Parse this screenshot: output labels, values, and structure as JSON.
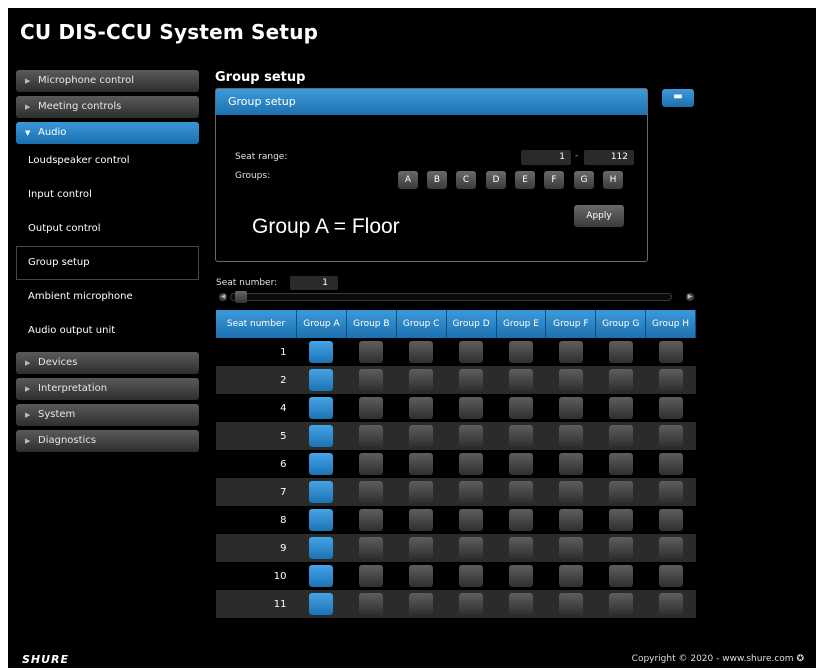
{
  "app_title": "CU DIS-CCU System Setup",
  "sidebar": {
    "items": [
      {
        "label": "Microphone control"
      },
      {
        "label": "Meeting controls"
      },
      {
        "label": "Audio"
      },
      {
        "label": "Devices"
      },
      {
        "label": "Interpretation"
      },
      {
        "label": "System"
      },
      {
        "label": "Diagnostics"
      }
    ],
    "audio_subitems": [
      {
        "label": "Loudspeaker control"
      },
      {
        "label": "Input control"
      },
      {
        "label": "Output control"
      },
      {
        "label": "Group setup"
      },
      {
        "label": "Ambient microphone"
      },
      {
        "label": "Audio output unit"
      }
    ]
  },
  "main": {
    "section_title": "Group setup",
    "panel": {
      "header": "Group setup",
      "seat_range_label": "Seat range:",
      "seat_range_from": "1",
      "seat_range_dash": "-",
      "seat_range_to": "112",
      "groups_label": "Groups:",
      "group_letters": [
        "A",
        "B",
        "C",
        "D",
        "E",
        "F",
        "G",
        "H"
      ],
      "apply_label": "Apply",
      "annotation": "Group A = Floor"
    },
    "seat_number_label": "Seat number:",
    "seat_number_value": "1",
    "table": {
      "headers": [
        "Seat number",
        "Group A",
        "Group B",
        "Group C",
        "Group D",
        "Group E",
        "Group F",
        "Group G",
        "Group H"
      ],
      "rows": [
        {
          "seat": "1",
          "groups": [
            true,
            false,
            false,
            false,
            false,
            false,
            false,
            false
          ]
        },
        {
          "seat": "2",
          "groups": [
            true,
            false,
            false,
            false,
            false,
            false,
            false,
            false
          ]
        },
        {
          "seat": "4",
          "groups": [
            true,
            false,
            false,
            false,
            false,
            false,
            false,
            false
          ]
        },
        {
          "seat": "5",
          "groups": [
            true,
            false,
            false,
            false,
            false,
            false,
            false,
            false
          ]
        },
        {
          "seat": "6",
          "groups": [
            true,
            false,
            false,
            false,
            false,
            false,
            false,
            false
          ]
        },
        {
          "seat": "7",
          "groups": [
            true,
            false,
            false,
            false,
            false,
            false,
            false,
            false
          ]
        },
        {
          "seat": "8",
          "groups": [
            true,
            false,
            false,
            false,
            false,
            false,
            false,
            false
          ]
        },
        {
          "seat": "9",
          "groups": [
            true,
            false,
            false,
            false,
            false,
            false,
            false,
            false
          ]
        },
        {
          "seat": "10",
          "groups": [
            true,
            false,
            false,
            false,
            false,
            false,
            false,
            false
          ]
        },
        {
          "seat": "11",
          "groups": [
            true,
            false,
            false,
            false,
            false,
            false,
            false,
            false
          ]
        }
      ]
    }
  },
  "footer": {
    "logo": "SHURE",
    "copyright": "Copyright © 2020 - www.shure.com"
  },
  "colors": {
    "accent": "#2a86cc",
    "background": "#000000",
    "button_dark": "#3a3a3a"
  }
}
